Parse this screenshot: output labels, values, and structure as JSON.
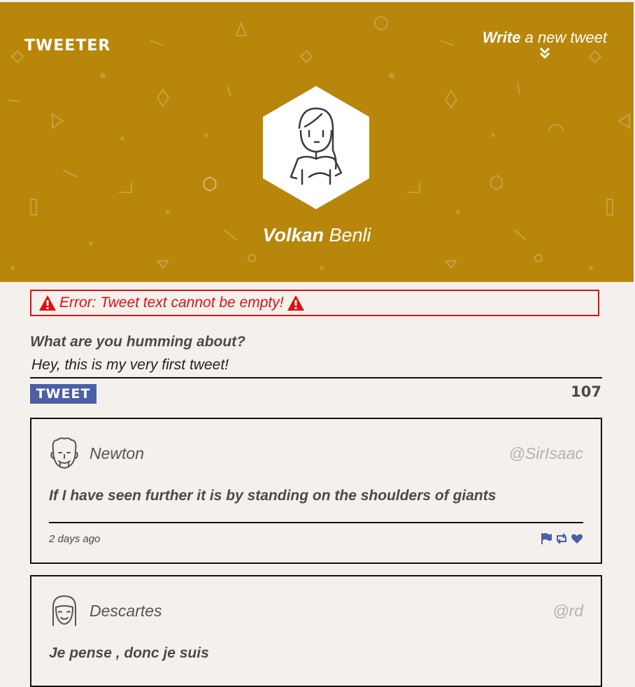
{
  "header": {
    "brand": "Tweeter",
    "write_bold": "Write",
    "write_rest": " a new tweet",
    "profile_first": "Volkan",
    "profile_last": " Benli"
  },
  "compose": {
    "error_text": "Error: Tweet text cannot be empty!",
    "label": "What are you humming about?",
    "value": "Hey, this is my very first tweet!",
    "button_label": "Tweet",
    "char_count": "107"
  },
  "tweets": [
    {
      "name": "Newton",
      "handle": "@SirIsaac",
      "text": "If I have seen further it is by standing on the shoulders of giants",
      "time": "2 days ago"
    },
    {
      "name": "Descartes",
      "handle": "@rd",
      "text": "Je pense , donc je suis"
    }
  ],
  "icons": {
    "flag": "flag-icon",
    "retweet": "retweet-icon",
    "like": "heart-icon",
    "write": "double-chevron-down-icon",
    "warning": "warning-icon"
  },
  "colors": {
    "header_bg": "#b8860b",
    "accent": "#4a5fa5",
    "error": "#e01010",
    "page_bg": "#f4f1ec"
  }
}
